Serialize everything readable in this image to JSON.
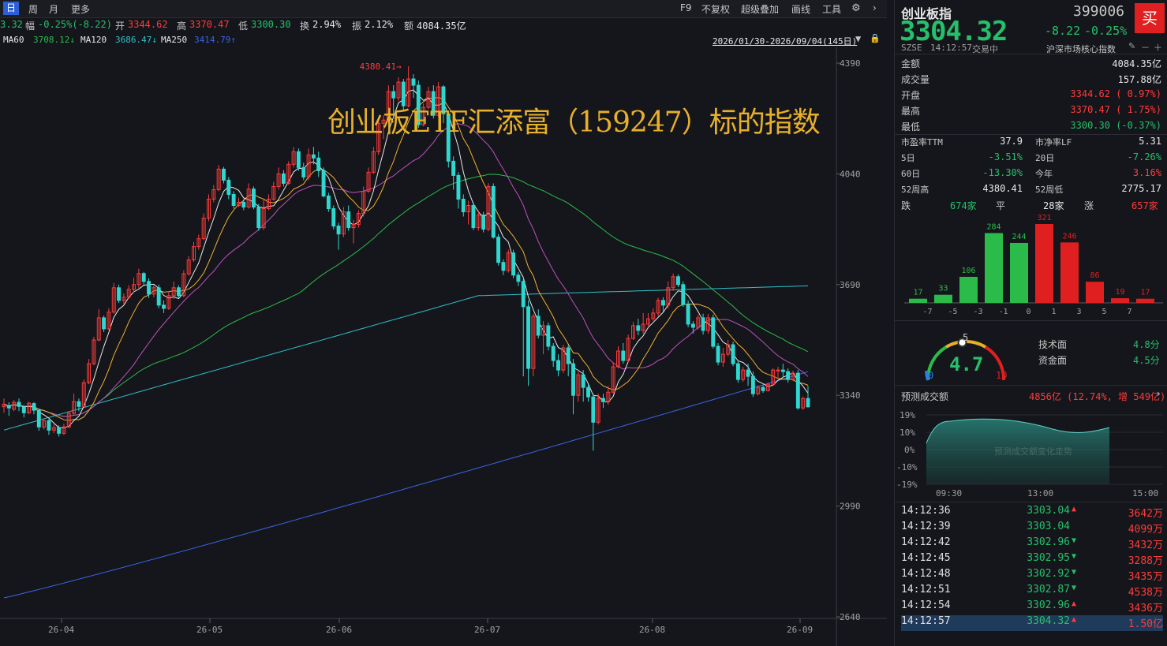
{
  "toolbar": {
    "periods": [
      "日",
      "周",
      "月",
      "更多"
    ],
    "right_items": [
      "F9",
      "不复权",
      "超级叠加",
      "画线",
      "工具"
    ]
  },
  "infobar": {
    "prefix": "3.32",
    "amp_label": "幅",
    "amp_value": "-0.25%(-8.22)",
    "open_label": "开",
    "open_value": "3344.62",
    "high_label": "高",
    "high_value": "3370.47",
    "low_label": "低",
    "low_value": "3300.30",
    "turnover_label": "换",
    "turnover_value": "2.94%",
    "amplitude_label": "振",
    "amplitude_value": "2.12%",
    "amount_label": "额",
    "amount_value": "4084.35亿"
  },
  "mabar": {
    "ma60_label": "MA60",
    "ma60_value": "3708.12↓",
    "ma120_label": "MA120",
    "ma120_value": "3686.47↓",
    "ma250_label": "MA250",
    "ma250_value": "3414.79↑",
    "range": "2026/01/30-2026/09/04(145日)"
  },
  "watermark": "创业板ETF汇添富（159247）标的指数",
  "chart_data": {
    "type": "candlestick",
    "peak_label": "4380.41",
    "y_ticks": [
      "4390",
      "4040",
      "3690",
      "3340",
      "2990",
      "2640"
    ],
    "y_range": [
      2640,
      4390
    ],
    "x_ticks": [
      "26-04",
      "26-05",
      "26-06",
      "26-07",
      "26-08",
      "26-09"
    ],
    "candles": [
      [
        3304,
        3312,
        3285,
        3330
      ],
      [
        3308,
        3300,
        3275,
        3318
      ],
      [
        3296,
        3318,
        3290,
        3325
      ],
      [
        3318,
        3305,
        3290,
        3330
      ],
      [
        3303,
        3285,
        3270,
        3310
      ],
      [
        3285,
        3315,
        3280,
        3320
      ],
      [
        3314,
        3293,
        3280,
        3318
      ],
      [
        3293,
        3240,
        3228,
        3298
      ],
      [
        3240,
        3260,
        3232,
        3268
      ],
      [
        3260,
        3230,
        3215,
        3265
      ],
      [
        3230,
        3238,
        3220,
        3248
      ],
      [
        3238,
        3220,
        3210,
        3245
      ],
      [
        3220,
        3240,
        3215,
        3250
      ],
      [
        3240,
        3283,
        3236,
        3290
      ],
      [
        3283,
        3320,
        3278,
        3345
      ],
      [
        3320,
        3305,
        3290,
        3330
      ],
      [
        3305,
        3380,
        3300,
        3390
      ],
      [
        3380,
        3440,
        3375,
        3455
      ],
      [
        3440,
        3515,
        3435,
        3525
      ],
      [
        3515,
        3585,
        3510,
        3612
      ],
      [
        3585,
        3550,
        3540,
        3592
      ],
      [
        3550,
        3603,
        3545,
        3615
      ],
      [
        3603,
        3680,
        3598,
        3695
      ],
      [
        3680,
        3640,
        3632,
        3690
      ],
      [
        3640,
        3650,
        3628,
        3662
      ],
      [
        3650,
        3675,
        3645,
        3688
      ],
      [
        3675,
        3690,
        3665,
        3712
      ],
      [
        3690,
        3725,
        3680,
        3740
      ],
      [
        3725,
        3700,
        3690,
        3730
      ],
      [
        3700,
        3660,
        3648,
        3710
      ],
      [
        3660,
        3680,
        3650,
        3688
      ],
      [
        3680,
        3625,
        3615,
        3690
      ],
      [
        3625,
        3615,
        3600,
        3640
      ],
      [
        3615,
        3655,
        3610,
        3668
      ],
      [
        3655,
        3680,
        3645,
        3700
      ],
      [
        3680,
        3655,
        3650,
        3688
      ],
      [
        3655,
        3724,
        3650,
        3735
      ],
      [
        3724,
        3768,
        3718,
        3780
      ],
      [
        3768,
        3810,
        3762,
        3825
      ],
      [
        3810,
        3835,
        3800,
        3848
      ],
      [
        3835,
        3900,
        3830,
        3915
      ],
      [
        3900,
        3960,
        3890,
        3975
      ],
      [
        3960,
        3990,
        3950,
        4005
      ],
      [
        3990,
        4055,
        3985,
        4068
      ],
      [
        4055,
        4020,
        4010,
        4062
      ],
      [
        4020,
        3975,
        3960,
        4030
      ],
      [
        3975,
        3940,
        3930,
        3985
      ],
      [
        3940,
        3950,
        3935,
        3965
      ],
      [
        3950,
        3935,
        3925,
        3960
      ],
      [
        3935,
        3992,
        3930,
        4010
      ],
      [
        3992,
        3935,
        3928,
        4000
      ],
      [
        3935,
        3870,
        3860,
        3945
      ],
      [
        3870,
        3930,
        3862,
        3962
      ],
      [
        3930,
        3960,
        3925,
        3975
      ],
      [
        3960,
        4000,
        3955,
        4015
      ],
      [
        4000,
        4040,
        3990,
        4060
      ],
      [
        4040,
        4010,
        4000,
        4052
      ],
      [
        4010,
        4070,
        4005,
        4080
      ],
      [
        4070,
        4110,
        4060,
        4125
      ],
      [
        4110,
        4060,
        4050,
        4120
      ],
      [
        4060,
        4030,
        4020,
        4075
      ],
      [
        4030,
        4100,
        4020,
        4120
      ],
      [
        4100,
        4090,
        4070,
        4125
      ],
      [
        4090,
        4050,
        4030,
        4110
      ],
      [
        4050,
        3970,
        3965,
        4060
      ],
      [
        3970,
        3930,
        3920,
        3980
      ],
      [
        3930,
        3875,
        3865,
        3940
      ],
      [
        3875,
        3850,
        3800,
        3885
      ],
      [
        3850,
        3920,
        3840,
        3935
      ],
      [
        3920,
        3870,
        3860,
        3940
      ],
      [
        3870,
        3880,
        3820,
        3895
      ],
      [
        3880,
        3915,
        3870,
        3925
      ],
      [
        3915,
        3985,
        3905,
        4000
      ],
      [
        3985,
        4045,
        3980,
        4060
      ],
      [
        4045,
        4110,
        4040,
        4125
      ],
      [
        4110,
        4200,
        4100,
        4215
      ],
      [
        4200,
        4210,
        4150,
        4225
      ],
      [
        4210,
        4300,
        4200,
        4320
      ],
      [
        4300,
        4280,
        4215,
        4320
      ],
      [
        4280,
        4330,
        4270,
        4345
      ],
      [
        4330,
        4255,
        4240,
        4340
      ],
      [
        4255,
        4340,
        4250,
        4380
      ],
      [
        4340,
        4320,
        4280,
        4355
      ],
      [
        4320,
        4195,
        4185,
        4335
      ],
      [
        4195,
        4250,
        4190,
        4262
      ],
      [
        4250,
        4300,
        4245,
        4315
      ],
      [
        4300,
        4225,
        4215,
        4320
      ],
      [
        4225,
        4315,
        4220,
        4330
      ],
      [
        4315,
        4230,
        4200,
        4320
      ],
      [
        4230,
        4080,
        4060,
        4240
      ],
      [
        4080,
        4035,
        3990,
        4095
      ],
      [
        4035,
        3960,
        3930,
        4045
      ],
      [
        3960,
        3920,
        3905,
        3975
      ],
      [
        3920,
        3940,
        3880,
        3955
      ],
      [
        3940,
        3870,
        3862,
        3950
      ],
      [
        3870,
        3910,
        3860,
        3925
      ],
      [
        3910,
        3865,
        3855,
        3920
      ],
      [
        3865,
        4000,
        3858,
        4010
      ],
      [
        4000,
        3840,
        3835,
        4010
      ],
      [
        3840,
        3760,
        3750,
        3850
      ],
      [
        3760,
        3735,
        3720,
        3770
      ],
      [
        3735,
        3790,
        3728,
        3800
      ],
      [
        3790,
        3720,
        3710,
        3800
      ],
      [
        3720,
        3700,
        3685,
        3730
      ],
      [
        3700,
        3620,
        3400,
        3715
      ],
      [
        3620,
        3425,
        3370,
        3640
      ],
      [
        3425,
        3590,
        3400,
        3598
      ],
      [
        3590,
        3530,
        3520,
        3612
      ],
      [
        3530,
        3560,
        3470,
        3575
      ],
      [
        3560,
        3495,
        3482,
        3570
      ],
      [
        3495,
        3450,
        3430,
        3505
      ],
      [
        3450,
        3420,
        3400,
        3470
      ],
      [
        3420,
        3490,
        3410,
        3500
      ],
      [
        3490,
        3440,
        3400,
        3500
      ],
      [
        3440,
        3340,
        3280,
        3455
      ],
      [
        3340,
        3405,
        3320,
        3415
      ],
      [
        3405,
        3365,
        3320,
        3420
      ],
      [
        3365,
        3335,
        3320,
        3375
      ],
      [
        3335,
        3255,
        3165,
        3345
      ],
      [
        3255,
        3330,
        3248,
        3345
      ],
      [
        3330,
        3320,
        3300,
        3345
      ],
      [
        3320,
        3350,
        3310,
        3370
      ],
      [
        3350,
        3430,
        3345,
        3445
      ],
      [
        3430,
        3480,
        3425,
        3495
      ],
      [
        3480,
        3450,
        3440,
        3505
      ],
      [
        3450,
        3520,
        3445,
        3532
      ],
      [
        3520,
        3560,
        3515,
        3572
      ],
      [
        3560,
        3545,
        3530,
        3582
      ],
      [
        3545,
        3565,
        3535,
        3600
      ],
      [
        3565,
        3582,
        3558,
        3600
      ],
      [
        3582,
        3600,
        3575,
        3615
      ],
      [
        3600,
        3640,
        3590,
        3648
      ],
      [
        3640,
        3625,
        3600,
        3650
      ],
      [
        3625,
        3680,
        3615,
        3700
      ],
      [
        3680,
        3715,
        3670,
        3725
      ],
      [
        3715,
        3690,
        3682,
        3722
      ],
      [
        3690,
        3627,
        3620,
        3700
      ],
      [
        3627,
        3565,
        3555,
        3640
      ],
      [
        3565,
        3555,
        3535,
        3575
      ],
      [
        3555,
        3585,
        3548,
        3595
      ],
      [
        3585,
        3545,
        3532,
        3598
      ],
      [
        3545,
        3585,
        3535,
        3597
      ],
      [
        3585,
        3495,
        3488,
        3595
      ],
      [
        3495,
        3445,
        3435,
        3505
      ],
      [
        3445,
        3470,
        3430,
        3490
      ],
      [
        3470,
        3500,
        3463,
        3515
      ],
      [
        3500,
        3440,
        3432,
        3510
      ],
      [
        3440,
        3390,
        3380,
        3450
      ],
      [
        3390,
        3420,
        3383,
        3430
      ],
      [
        3420,
        3400,
        3370,
        3440
      ],
      [
        3400,
        3345,
        3335,
        3415
      ],
      [
        3345,
        3365,
        3340,
        3372
      ],
      [
        3365,
        3355,
        3348,
        3372
      ],
      [
        3355,
        3375,
        3352,
        3380
      ],
      [
        3375,
        3420,
        3370,
        3425
      ],
      [
        3420,
        3420,
        3395,
        3430
      ],
      [
        3420,
        3415,
        3395,
        3440
      ],
      [
        3415,
        3390,
        3380,
        3425
      ],
      [
        3390,
        3410,
        3385,
        3418
      ],
      [
        3410,
        3300,
        3295,
        3420
      ],
      [
        3300,
        3330,
        3294,
        3336
      ],
      [
        3330,
        3304,
        3300,
        3370
      ]
    ],
    "ma_colors": {
      "ma5": "#e8e8e8",
      "ma10": "#f0b030",
      "ma20": "#c04fc0",
      "ma60": "#2bbb4a",
      "ma120": "#2fc0c8",
      "ma250": "#3b64e8"
    },
    "down_color": "#2fd7d0",
    "up_color": "#ff3b3b"
  },
  "quote": {
    "name": "创业板指",
    "code": "399006",
    "buy_label": "买",
    "price": "3304.32",
    "change": "-8.22",
    "change_pct": "-0.25%",
    "exchange": "SZSE",
    "time": "14:12:57",
    "status": "交易中",
    "index_label": "沪深市场核心指数"
  },
  "stats": [
    {
      "k": "金额",
      "v": "4084.35亿",
      "c": "white"
    },
    {
      "k": "成交量",
      "v": "157.88亿",
      "c": "white"
    },
    {
      "k": "开盘",
      "v": "3344.62 ( 0.97%)",
      "c": "red"
    },
    {
      "k": "最高",
      "v": "3370.47 ( 1.75%)",
      "c": "red"
    },
    {
      "k": "最低",
      "v": "3300.30 (-0.37%)",
      "c": "green"
    }
  ],
  "stats2": [
    {
      "k1": "市盈率TTM",
      "v1": "37.9",
      "c1": "white",
      "k2": "市净率LF",
      "v2": "5.31",
      "c2": "white"
    },
    {
      "k1": "5日",
      "v1": "-3.51%",
      "c1": "green",
      "k2": "20日",
      "v2": "-7.26%",
      "c2": "green"
    },
    {
      "k1": "60日",
      "v1": "-13.30%",
      "c1": "green",
      "k2": "今年",
      "v2": "3.16%",
      "c2": "red"
    },
    {
      "k1": "52周高",
      "v1": "4380.41",
      "c1": "white",
      "k2": "52周低",
      "v2": "2775.17",
      "c2": "white"
    }
  ],
  "breadth": {
    "fall_label": "跌",
    "fall_value": "674家",
    "flat_label": "平",
    "flat_value": "28家",
    "rise_label": "涨",
    "rise_value": "657家"
  },
  "distribution": {
    "counts": [
      17,
      33,
      106,
      284,
      244,
      321,
      246,
      86,
      19,
      17
    ],
    "colors": [
      "#2bbb4a",
      "#2bbb4a",
      "#2bbb4a",
      "#2bbb4a",
      "#2bbb4a",
      "#e02020",
      "#e02020",
      "#e02020",
      "#e02020",
      "#e02020"
    ],
    "x_labels": [
      "-7",
      "-5",
      "-3",
      "-1",
      "0",
      "1",
      "3",
      "5",
      "7"
    ]
  },
  "gauge": {
    "score": "4.7",
    "min": "0",
    "mid": "5",
    "max": "10",
    "value_fraction": 0.47,
    "tech_label": "技术面",
    "tech_value": "4.8分",
    "fund_label": "资金面",
    "fund_value": "4.5分"
  },
  "forecast": {
    "title": "预测成交额",
    "value": "4856亿 (12.74%, 增 549亿)",
    "y_labels": [
      "19%",
      "10%",
      "0%",
      "-10%",
      "-19%"
    ],
    "x_labels": [
      "09:30",
      "13:00",
      "15:00"
    ],
    "watermark": "预测成交额变化走势"
  },
  "ticks": [
    {
      "t": "14:12:36",
      "p": "3303.04",
      "a": "▲",
      "v": "3642万"
    },
    {
      "t": "14:12:39",
      "p": "3303.04",
      "a": "",
      "v": "4099万"
    },
    {
      "t": "14:12:42",
      "p": "3302.96",
      "a": "▼",
      "v": "3432万"
    },
    {
      "t": "14:12:45",
      "p": "3302.95",
      "a": "▼",
      "v": "3288万"
    },
    {
      "t": "14:12:48",
      "p": "3302.92",
      "a": "▼",
      "v": "3435万"
    },
    {
      "t": "14:12:51",
      "p": "3302.87",
      "a": "▼",
      "v": "4538万"
    },
    {
      "t": "14:12:54",
      "p": "3302.96",
      "a": "▲",
      "v": "3436万"
    },
    {
      "t": "14:12:57",
      "p": "3304.32",
      "a": "▲",
      "v": "1.50亿"
    }
  ]
}
